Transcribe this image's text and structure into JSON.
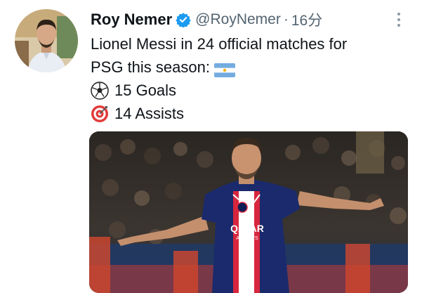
{
  "tweet": {
    "author": {
      "display_name": "Roy Nemer",
      "handle": "@RoyNemer",
      "verified": true,
      "avatar_icon": "profile-photo"
    },
    "separator": "·",
    "time": "16分",
    "text_lines": [
      "Lionel Messi in 24 official matches for",
      "PSG this season:",
      "15 Goals",
      "14 Assists"
    ],
    "emojis": {
      "flag": "argentina-flag",
      "goals": "soccer-ball",
      "assists": "direct-hit"
    },
    "media": {
      "shirt_sponsor": "QATAR",
      "shirt_sponsor_sub": "AIRWAYS"
    }
  },
  "colors": {
    "text": "#0f1419",
    "secondary": "#536471",
    "verified": "#1d9bf0",
    "jersey": "#1a2a6c",
    "jersey_stripe": "#d7263d"
  }
}
